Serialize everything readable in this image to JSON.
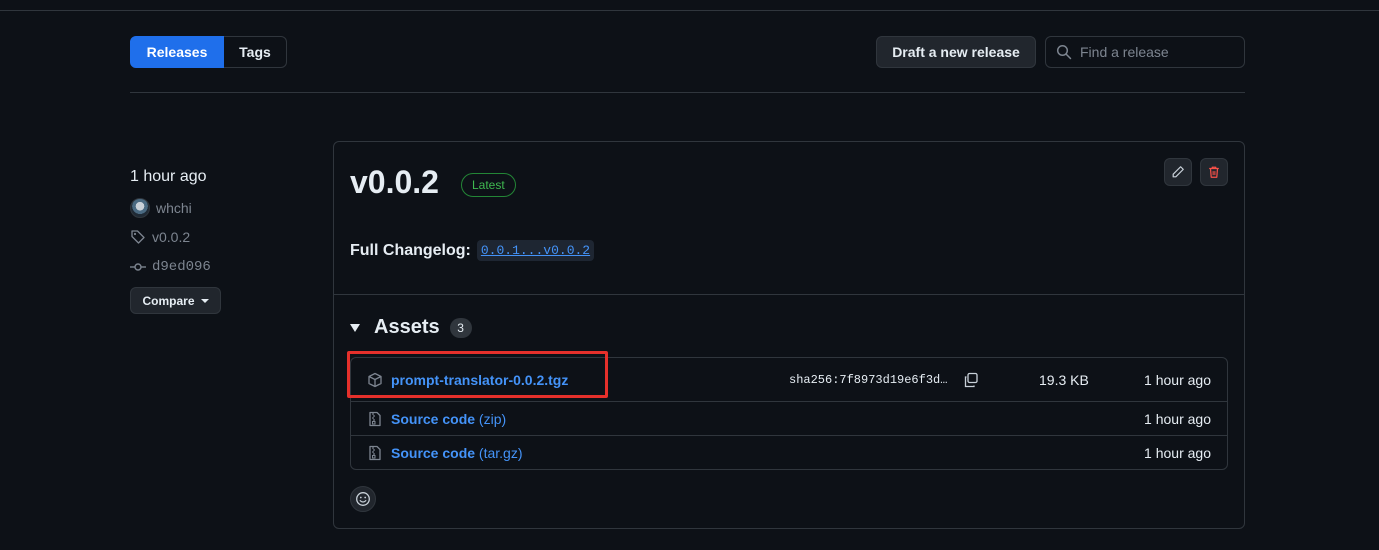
{
  "tabs": {
    "releases": "Releases",
    "tags": "Tags"
  },
  "toolbar": {
    "draft_label": "Draft a new release",
    "search_placeholder": "Find a release"
  },
  "sidebar": {
    "time": "1 hour ago",
    "author": "whchi",
    "tag": "v0.0.2",
    "commit": "d9ed096",
    "compare_label": "Compare"
  },
  "release": {
    "version": "v0.0.2",
    "badge": "Latest",
    "changelog_label": "Full Changelog:",
    "changelog_link": "0.0.1...v0.0.2"
  },
  "assets": {
    "title": "Assets",
    "count": "3",
    "items": [
      {
        "name": "prompt-translator-0.0.2.tgz",
        "sha": "sha256:7f8973d19e6f3d…",
        "size": "19.3 KB",
        "time": "1 hour ago",
        "icon": "package-icon"
      },
      {
        "name": "Source code",
        "suffix": "(zip)",
        "time": "1 hour ago",
        "icon": "file-zip-icon"
      },
      {
        "name": "Source code",
        "suffix": "(tar.gz)",
        "time": "1 hour ago",
        "icon": "file-zip-icon"
      }
    ]
  },
  "colors": {
    "accent": "#1f6feb",
    "link": "#4493f8",
    "latest": "#3fb950",
    "danger": "#f85149",
    "highlight": "#e5302b"
  }
}
